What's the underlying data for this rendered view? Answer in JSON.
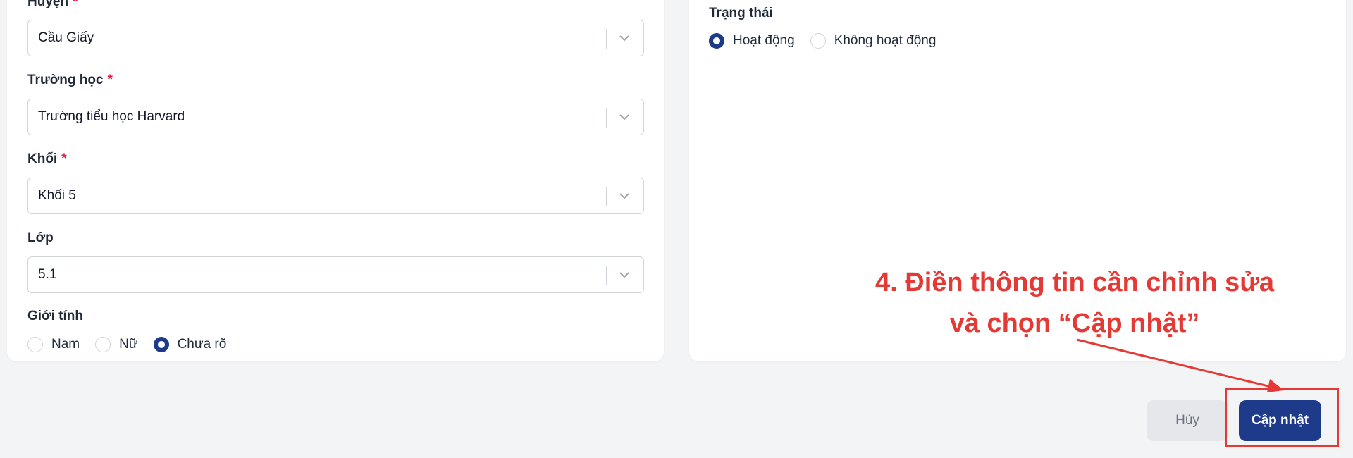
{
  "form": {
    "district": {
      "label": "Huyện",
      "required_mark": "*",
      "value": "Cầu Giấy"
    },
    "school": {
      "label": "Trường học",
      "required_mark": "*",
      "value": "Trường tiểu học Harvard"
    },
    "grade": {
      "label": "Khối",
      "required_mark": "*",
      "value": "Khối 5"
    },
    "class": {
      "label": "Lớp",
      "value": "5.1"
    },
    "gender": {
      "label": "Giới tính",
      "options": [
        "Nam",
        "Nữ",
        "Chưa rõ"
      ],
      "selected": "Chưa rõ"
    },
    "status": {
      "label": "Trạng thái",
      "options": [
        "Hoạt động",
        "Không hoạt động"
      ],
      "selected": "Hoạt động"
    }
  },
  "footer": {
    "cancel_label": "Hủy",
    "update_label": "Cập nhật"
  },
  "annotation": {
    "line1": "4. Điền thông tin cần chỉnh sửa",
    "line2": "và chọn “Cập nhật”"
  },
  "colors": {
    "primary": "#1e3a8a",
    "required": "#e11d48",
    "annotation": "#e53935"
  },
  "icons": {
    "select_toggle": "chevron-down-icon",
    "arrow": "arrow-icon"
  }
}
